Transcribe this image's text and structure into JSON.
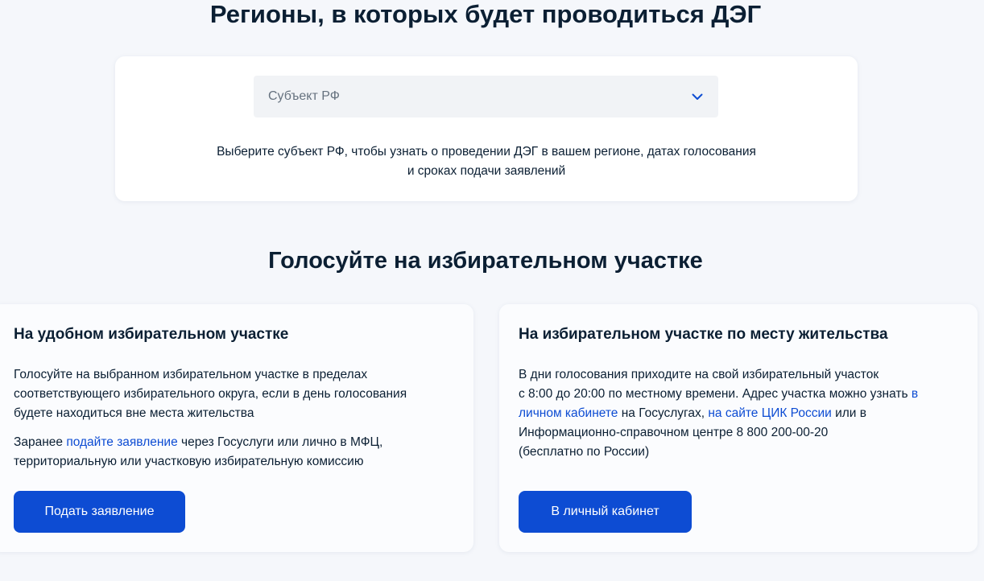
{
  "header": {
    "title": "Регионы, в которых будет проводиться ДЭГ"
  },
  "region_select": {
    "placeholder": "Субъект РФ",
    "hint_line1": "Выберите субъект РФ, чтобы узнать о проведении ДЭГ в вашем регионе, датах голосования",
    "hint_line2": "и сроках подачи заявлений"
  },
  "section": {
    "title": "Голосуйте на избирательном участке"
  },
  "card_convenient": {
    "title": "На удобном избирательном участке",
    "p1_line1": "Голосуйте на выбранном избирательном участке в пределах",
    "p1_line2": "соответствующего избирательного округа, если в день голосования",
    "p1_line3": "будете находиться вне места жительства",
    "p2_before": "Заранее ",
    "p2_link": "подайте заявление",
    "p2_after": " через Госуслуги или лично в МФЦ,",
    "p2_line2": "территориальную или участковую избирательную комиссию",
    "button_label": "Подать заявление"
  },
  "card_residence": {
    "title": "На избирательном участке по месту жительства",
    "line1": "В дни голосования приходите на свой избирательный участок",
    "line2_before": "с 8:00 до 20:00 по местному времени. Адрес участка можно узнать ",
    "line2_link": "в",
    "line3_link": "личном кабинете",
    "line3_mid": " на Госуслугах, ",
    "line3_link2": "на сайте ЦИК России",
    "line3_after": " или в",
    "line4": "Информационно-справочном центре 8 800 200-00-20",
    "line5": "(бесплатно по России)",
    "button_label": "В личный кабинет"
  },
  "colors": {
    "accent": "#0d4cd3",
    "text": "#0b1f33",
    "background": "#f5f7fb"
  }
}
